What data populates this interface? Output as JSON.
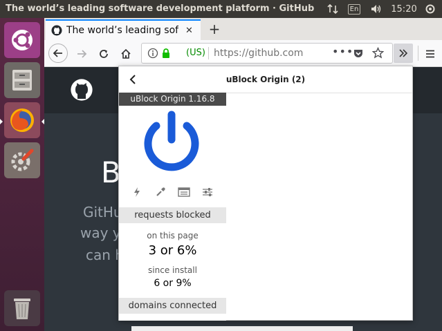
{
  "window": {
    "title": "The world’s leading software development platform · GitHub - M"
  },
  "system_tray": {
    "keyboard_layout": "En",
    "clock": "15:20"
  },
  "launcher": {
    "items": [
      "ubuntu-dash",
      "file-manager",
      "firefox",
      "system-settings",
      "trash"
    ]
  },
  "browser": {
    "tab_title": "The world’s leading soft",
    "url_identity": "(US)",
    "url": "https://github.com",
    "new_tab_label": "+"
  },
  "page": {
    "hero_big": "B",
    "hero_lines": [
      "GitHu",
      "way y",
      "can h"
    ]
  },
  "popup": {
    "title": "uBlock Origin (2)",
    "version": "uBlock Origin 1.16.8",
    "requests_blocked_label": "requests blocked",
    "on_this_page_label": "on this page",
    "on_this_page_value": "3 or 6%",
    "since_install_label": "since install",
    "since_install_value": "6 or 9%",
    "domains_connected_label": "domains connected"
  },
  "colors": {
    "power_blue": "#1a5bd8",
    "accent_green": "#12bc00",
    "panel_dark": "#3a3834"
  }
}
